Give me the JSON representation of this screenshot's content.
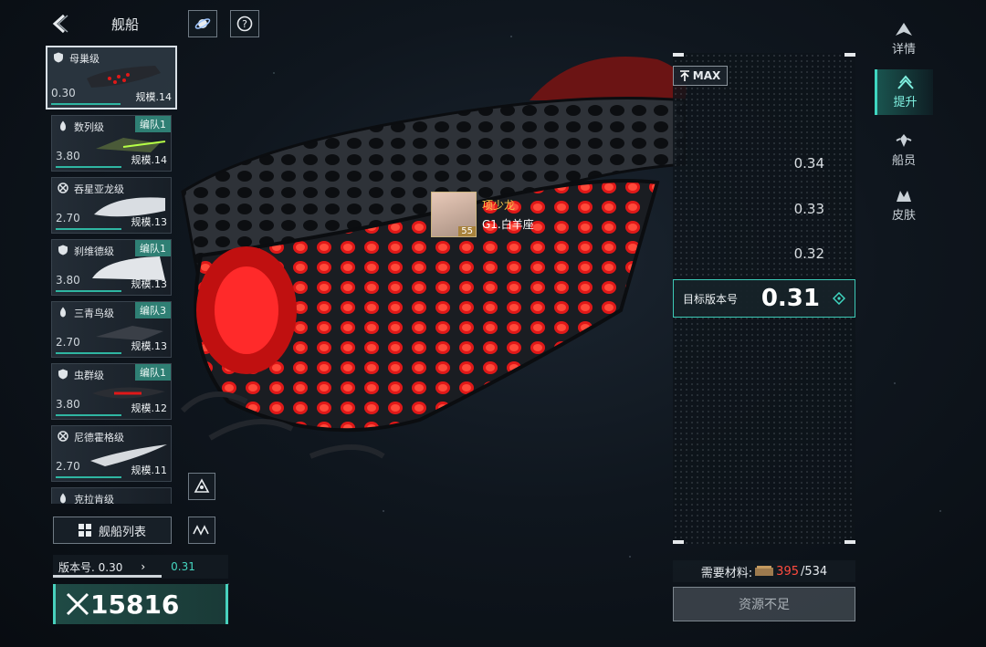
{
  "header": {
    "title": "舰船"
  },
  "ships": [
    {
      "name": "母巢级",
      "value": "0.30",
      "scale": "规模.14",
      "fleet": "",
      "icon": "shield-icon",
      "selected": true
    },
    {
      "name": "数列级",
      "value": "3.80",
      "scale": "规模.14",
      "fleet": "编队1",
      "icon": "flame-icon"
    },
    {
      "name": "吞星亚龙级",
      "value": "2.70",
      "scale": "规模.13",
      "fleet": "",
      "icon": "target-icon"
    },
    {
      "name": "刹维德级",
      "value": "3.80",
      "scale": "规模.13",
      "fleet": "编队1",
      "icon": "shield-icon"
    },
    {
      "name": "三青鸟级",
      "value": "2.70",
      "scale": "规模.13",
      "fleet": "编队3",
      "icon": "flame-icon"
    },
    {
      "name": "虫群级",
      "value": "3.80",
      "scale": "规模.12",
      "fleet": "编队1",
      "icon": "shield-icon"
    },
    {
      "name": "尼德霍格级",
      "value": "2.70",
      "scale": "规模.11",
      "fleet": "",
      "icon": "target-icon"
    },
    {
      "name": "克拉肯级",
      "value": "",
      "scale": "",
      "fleet": "",
      "icon": "flame-icon"
    }
  ],
  "ship_list_button": "舰船列表",
  "version": {
    "label": "版本号. 0.30",
    "next": "0.31",
    "progress": 0.62
  },
  "power": "15816",
  "crew": {
    "name": "项少龙",
    "sign": "G1.白羊座",
    "level": "55"
  },
  "picker": {
    "max_label": "MAX",
    "options": [
      "0.34",
      "0.33",
      "0.32"
    ],
    "target_label": "目标版本号",
    "target_value": "0.31"
  },
  "materials": {
    "label": "需要材料:",
    "have": "395",
    "need": "/534"
  },
  "upgrade_button": "资源不足",
  "tabs": [
    {
      "label": "详情",
      "active": false
    },
    {
      "label": "提升",
      "active": true
    },
    {
      "label": "船员",
      "active": false
    },
    {
      "label": "皮肤",
      "active": false
    }
  ],
  "colors": {
    "accent": "#3fd6c0",
    "warning": "#ff4b3f",
    "crew_name": "#f4c74a"
  }
}
